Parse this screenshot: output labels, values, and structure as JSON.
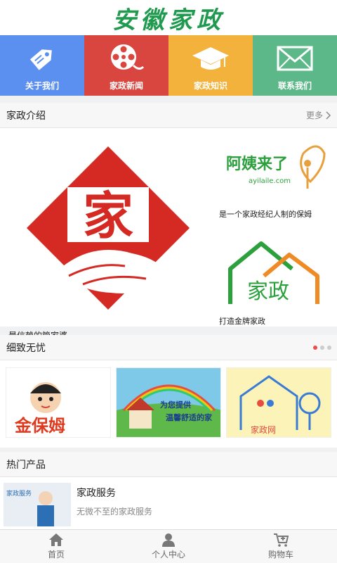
{
  "header": {
    "title": "安徽家政"
  },
  "nav": [
    {
      "label": "关于我们",
      "icon": "tag-icon",
      "color": "#5b8ff0"
    },
    {
      "label": "家政新闻",
      "icon": "film-reel-icon",
      "color": "#d9453f"
    },
    {
      "label": "家政知识",
      "icon": "graduation-cap-icon",
      "color": "#f3b23b"
    },
    {
      "label": "联系我们",
      "icon": "envelope-icon",
      "color": "#5cb889"
    }
  ],
  "intro": {
    "title": "家政介绍",
    "more": "更多",
    "main": {
      "caption": "最信赖的管家婆",
      "logo_char": "家"
    },
    "side": [
      {
        "caption": "是一个家政经纪人制的保姆",
        "logo_title": "阿姨来了",
        "logo_sub": "ayilaile.com"
      },
      {
        "caption": "打造金牌家政",
        "logo_text": "家政"
      }
    ]
  },
  "worry": {
    "title": "细致无忧",
    "slides": [
      {
        "text": "金保姆"
      },
      {
        "line1": "为您提供",
        "line2": "温馨舒适的家"
      },
      {
        "text": "家政网"
      }
    ]
  },
  "hot": {
    "title": "热门产品",
    "items": [
      {
        "name": "家政服务",
        "desc": "无微不至的家政服务",
        "thumb_text": "家政服务"
      }
    ]
  },
  "tabbar": [
    {
      "label": "首页",
      "icon": "home-icon"
    },
    {
      "label": "个人中心",
      "icon": "user-icon"
    },
    {
      "label": "购物车",
      "icon": "cart-icon"
    }
  ]
}
